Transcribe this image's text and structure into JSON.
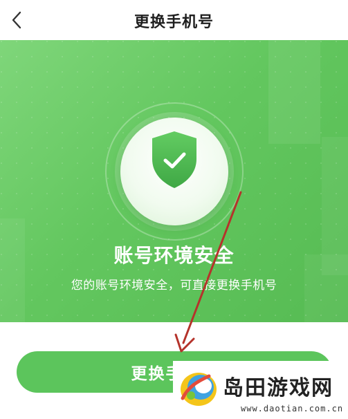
{
  "header": {
    "title": "更换手机号",
    "back_icon": "chevron-left-icon"
  },
  "hero": {
    "icon": "shield-check-icon",
    "status_title": "账号环境安全",
    "description": "您的账号环境安全，可直接更换手机号",
    "colors": {
      "gradient_start": "#7fd67a",
      "gradient_end": "#56bb53"
    }
  },
  "action": {
    "label": "更换手机号",
    "color": "#5cc55c"
  },
  "annotation": {
    "arrow_color": "#b5332b"
  },
  "watermark": {
    "name": "岛田游戏网",
    "url": "www.daotian.com.cn"
  }
}
